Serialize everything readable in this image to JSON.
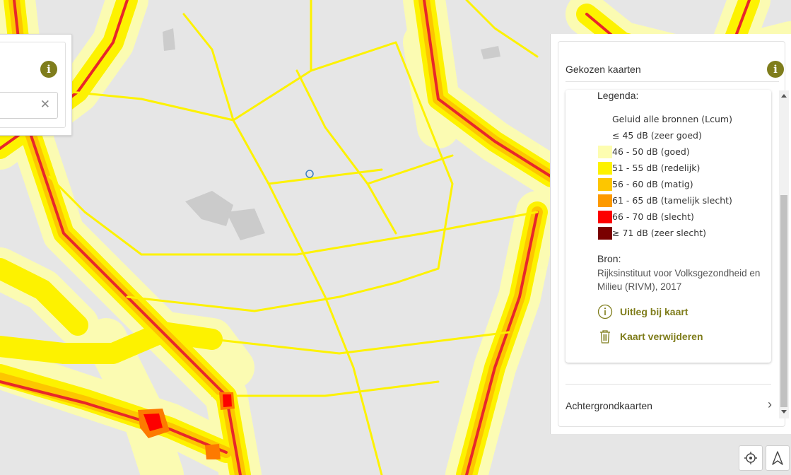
{
  "panel": {
    "title": "Gekozen kaarten",
    "legend_heading": "Legenda:",
    "legend": [
      {
        "label": "Geluid alle bronnen (Lcum)",
        "color": ""
      },
      {
        "label": "≤ 45 dB (zeer goed)",
        "color": ""
      },
      {
        "label": "46 - 50 dB (goed)",
        "color": "#fdfdb0"
      },
      {
        "label": "51 - 55 dB (redelijk)",
        "color": "#fdf200"
      },
      {
        "label": "56 - 60 dB (matig)",
        "color": "#fdc600"
      },
      {
        "label": "61 - 65 dB (tamelijk slecht)",
        "color": "#fd9a00"
      },
      {
        "label": "66 - 70 dB (slecht)",
        "color": "#fd0000"
      },
      {
        "label": "≥ 71 dB (zeer slecht)",
        "color": "#7a0000"
      }
    ],
    "source_heading": "Bron:",
    "source_text": "Rijksinstituut voor Volksgezondheid en Milieu (RIVM), 2017",
    "explain_label": "Uitleg bij kaart",
    "remove_label": "Kaart verwijderen",
    "background_maps_label": "Achtergrondkaarten"
  },
  "colors": {
    "accent": "#7f7d1c",
    "map_background": "#e6e6e6",
    "road_light": "#fdfdb0",
    "road_yellow": "#fdf200",
    "road_orange": "#fd9a00",
    "road_red": "#e8262a"
  },
  "icons": {
    "info": "info-icon",
    "clear": "close-icon",
    "explain": "info-circle-icon",
    "remove": "trash-icon",
    "expand": "chevron-right-icon",
    "locate": "crosshair-icon",
    "north": "north-arrow-icon"
  }
}
